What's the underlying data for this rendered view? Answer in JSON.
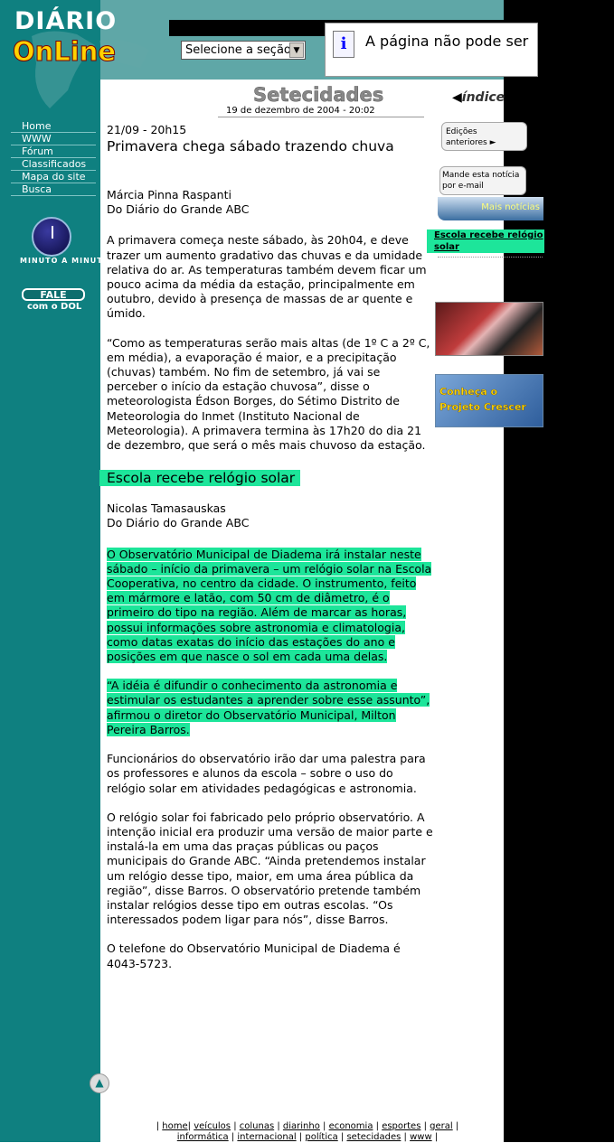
{
  "header": {
    "logo_top": "DIÁRIO",
    "logo_bottom": "OnLine",
    "section_select": "Selecione a seção",
    "error_text": "A página não pode ser",
    "error_icon": "info-icon"
  },
  "section": {
    "title": "Setecidades",
    "date": "19 de dezembro de 2004 - 20:02",
    "index_label": "índice"
  },
  "nav": {
    "items": [
      "Home",
      "WWW",
      "Fórum",
      "Classificados",
      "Mapa do site",
      "Busca"
    ],
    "minuto": "MINUTO A MINUTO",
    "fale_top": "FALE",
    "fale_bottom": "com o DOL"
  },
  "article1": {
    "datetime": "21/09 - 20h15",
    "headline": "Primavera chega sábado trazendo chuva",
    "author": "Márcia Pinna Raspanti",
    "source": "Do Diário do Grande ABC",
    "p1": "  A primavera começa neste sábado, às 20h04, e deve trazer um aumento gradativo das chuvas e da umidade relativa do ar. As temperaturas também devem ficar um pouco acima da média da estação, principalmente em outubro, devido à presença de massas de ar quente e úmido.",
    "p2": "“Como as temperaturas serão mais altas (de 1º C a 2º C, em média), a evaporação é maior, e a precipitação (chuvas) também. No fim de setembro, já vai se perceber o início da estação chuvosa”, disse o meteorologista Édson Borges, do Sétimo Distrito de Meteorologia do Inmet (Instituto Nacional de Meteorologia). A primavera termina às 17h20 do dia 21 de dezembro, que será o mês mais chuvoso da estação."
  },
  "article2": {
    "headline": "Escola recebe relógio solar",
    "author": "Nicolas Tamasauskas",
    "source": "Do Diário do Grande ABC",
    "p1": "  O Observatório Municipal de Diadema irá instalar neste sábado – início da primavera – um relógio solar na Escola Cooperativa, no centro da cidade. O instrumento, feito em mármore e latão, com 50 cm de diâmetro, é o primeiro do tipo na região. Além de marcar as horas, possui informações sobre astronomia e climatologia, como datas exatas do início das estações do ano e posições em que nasce o sol em cada uma delas.",
    "p2": "“A idéia é difundir o conhecimento da astronomia e estimular os estudantes a aprender sobre esse assunto”, afirmou o diretor do Observatório Municipal, Milton Pereira Barros.",
    "p3": "Funcionários do observatório irão dar uma palestra para os professores e alunos da escola – sobre o uso do relógio solar em atividades pedagógicas e astronomia.",
    "p4": "O relógio solar foi fabricado pelo próprio observatório. A intenção inicial era produzir uma versão de maior parte e instalá-la em uma das praças públicas ou paços municipais do Grande ABC. “Ainda pretendemos instalar um relógio desse tipo, maior, em uma área pública da região”, disse Barros. O observatório pretende também instalar relógios desse tipo em outras escolas. “Os interessados podem ligar para nós”, disse Barros.",
    "p5": "O telefone do Observatório Municipal de Diadema é 4043-5723."
  },
  "right": {
    "edicoes_1": "Edições",
    "edicoes_2": "anteriores ►",
    "mande_1": "Mande esta notícia",
    "mande_2": "por e-mail",
    "mais": "Mais notícias",
    "escola_link": "Escola recebe relógio solar",
    "crescer_1": "Conheça o",
    "crescer_2": "Projeto Crescer"
  },
  "footer": {
    "row1": [
      "home",
      "veículos",
      "colunas",
      "diarinho",
      "economia",
      "esportes",
      "geral"
    ],
    "row2": [
      "informática",
      "internacional",
      "política",
      "setecidades",
      "www"
    ]
  },
  "colors": {
    "teal": "#0f8080",
    "highlight": "#1de59a",
    "logo_yellow": "#ffd200"
  }
}
